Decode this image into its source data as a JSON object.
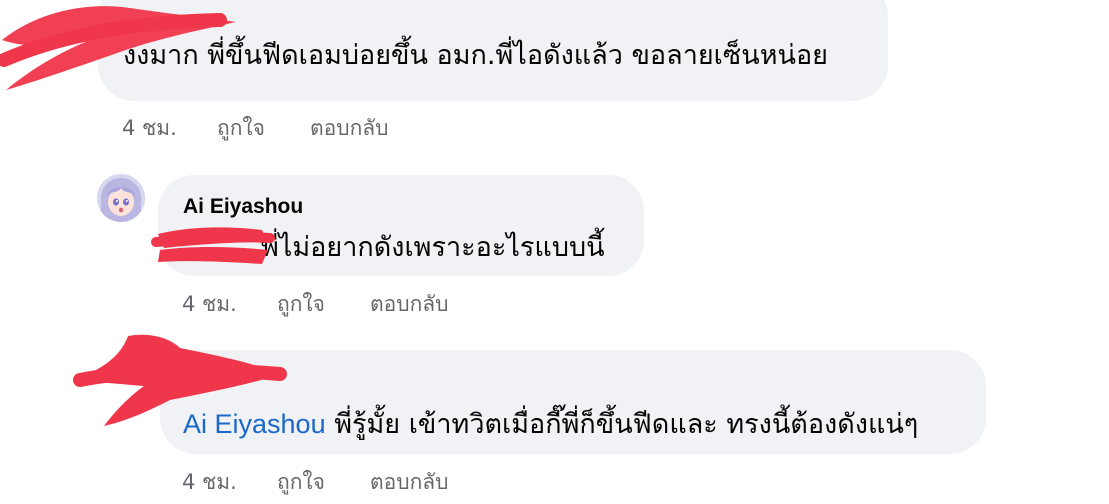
{
  "comments": [
    {
      "author": "",
      "text": "งงมาก พี่ขึ้นฟีดเอมบ่อยขึ้น อมก.พี่ไอดังแล้ว ขอลายเซ็นหน่อย",
      "time": "4 ชม.",
      "like_label": "ถูกใจ",
      "reply_label": "ตอบกลับ"
    },
    {
      "author": "Ai Eiyashou",
      "text": "พี่ไม่อยากดังเพราะอะไรแบบนี้",
      "time": "4 ชม.",
      "like_label": "ถูกใจ",
      "reply_label": "ตอบกลับ"
    },
    {
      "author": "",
      "mention": "Ai Eiyashou",
      "text": "พี่รู้มั้ย เข้าทวิตเมื่อกี๊พี่ก็ขึ้นฟีดและ ทรงนี้ต้องดังแน่ๆ",
      "time": "4 ชม.",
      "like_label": "ถูกใจ",
      "reply_label": "ตอบกลับ"
    }
  ],
  "colors": {
    "bubble": "#f0f2f5",
    "text": "#050505",
    "meta": "#65676b",
    "mention": "#1a68c9",
    "redaction": "#f0364a"
  },
  "icons": {
    "avatar": "anime-girl-avatar"
  }
}
